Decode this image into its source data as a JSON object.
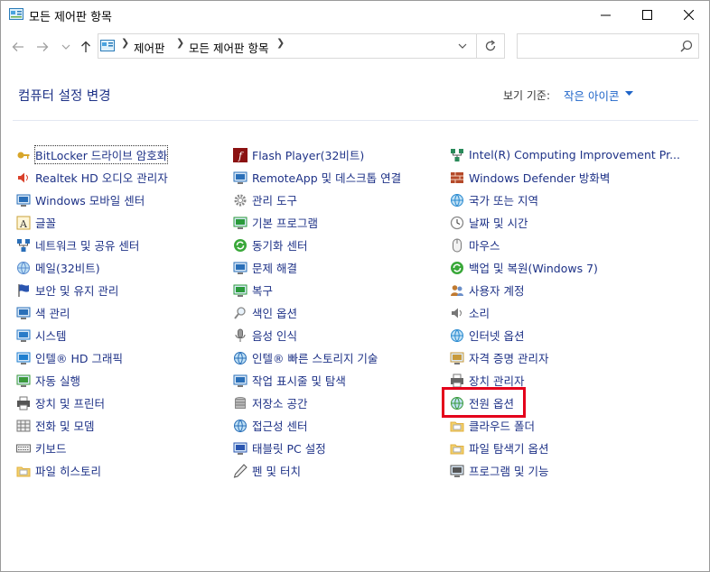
{
  "window": {
    "title": "모든 제어판 항목",
    "controls": [
      "minimize",
      "maximize",
      "close"
    ]
  },
  "nav": {
    "breadcrumb": [
      "제어판",
      "모든 제어판 항목"
    ],
    "search_placeholder": ""
  },
  "header": {
    "title": "컴퓨터 설정 변경",
    "view_label": "보기 기준:",
    "view_value": "작은 아이콘"
  },
  "columns": [
    [
      {
        "label": "BitLocker 드라이브 암호화",
        "icon": "bitlocker-icon"
      },
      {
        "label": "Realtek HD 오디오 관리자",
        "icon": "realtek-audio-icon"
      },
      {
        "label": "Windows 모바일 센터",
        "icon": "mobility-center-icon"
      },
      {
        "label": "글꼴",
        "icon": "fonts-icon"
      },
      {
        "label": "네트워크 및 공유 센터",
        "icon": "network-icon"
      },
      {
        "label": "메일(32비트)",
        "icon": "mail-icon"
      },
      {
        "label": "보안 및 유지 관리",
        "icon": "flag-icon"
      },
      {
        "label": "색 관리",
        "icon": "color-management-icon"
      },
      {
        "label": "시스템",
        "icon": "system-icon"
      },
      {
        "label": "인텔® HD 그래픽",
        "icon": "intel-graphics-icon"
      },
      {
        "label": "자동 실행",
        "icon": "autoplay-icon"
      },
      {
        "label": "장치 및 프린터",
        "icon": "devices-printers-icon"
      },
      {
        "label": "전화 및 모뎀",
        "icon": "phone-modem-icon"
      },
      {
        "label": "키보드",
        "icon": "keyboard-icon"
      },
      {
        "label": "파일 히스토리",
        "icon": "file-history-icon"
      }
    ],
    [
      {
        "label": "Flash Player(32비트)",
        "icon": "flash-icon"
      },
      {
        "label": "RemoteApp 및 데스크톱 연결",
        "icon": "remoteapp-icon"
      },
      {
        "label": "관리 도구",
        "icon": "admin-tools-icon"
      },
      {
        "label": "기본 프로그램",
        "icon": "default-programs-icon"
      },
      {
        "label": "동기화 센터",
        "icon": "sync-center-icon"
      },
      {
        "label": "문제 해결",
        "icon": "troubleshooting-icon"
      },
      {
        "label": "복구",
        "icon": "recovery-icon"
      },
      {
        "label": "색인 옵션",
        "icon": "indexing-icon"
      },
      {
        "label": "음성 인식",
        "icon": "speech-recognition-icon"
      },
      {
        "label": "인텔® 빠른 스토리지 기술",
        "icon": "intel-rst-icon"
      },
      {
        "label": "작업 표시줄 및 탐색",
        "icon": "taskbar-icon"
      },
      {
        "label": "저장소 공간",
        "icon": "storage-spaces-icon"
      },
      {
        "label": "접근성 센터",
        "icon": "ease-of-access-icon"
      },
      {
        "label": "태블릿 PC 설정",
        "icon": "tablet-pc-icon"
      },
      {
        "label": "펜 및 터치",
        "icon": "pen-touch-icon"
      }
    ],
    [
      {
        "label": "Intel(R) Computing Improvement Pr...",
        "icon": "intel-cip-icon"
      },
      {
        "label": "Windows Defender 방화벽",
        "icon": "firewall-icon"
      },
      {
        "label": "국가 또는 지역",
        "icon": "region-icon"
      },
      {
        "label": "날짜 및 시간",
        "icon": "date-time-icon"
      },
      {
        "label": "마우스",
        "icon": "mouse-icon"
      },
      {
        "label": "백업 및 복원(Windows 7)",
        "icon": "backup-restore-icon"
      },
      {
        "label": "사용자 계정",
        "icon": "user-accounts-icon"
      },
      {
        "label": "소리",
        "icon": "sound-icon"
      },
      {
        "label": "인터넷 옵션",
        "icon": "internet-options-icon"
      },
      {
        "label": "자격 증명 관리자",
        "icon": "credential-manager-icon"
      },
      {
        "label": "장치 관리자",
        "icon": "device-manager-icon"
      },
      {
        "label": "전원 옵션",
        "icon": "power-options-icon"
      },
      {
        "label": "클라우드 폴더",
        "icon": "work-folders-icon"
      },
      {
        "label": "파일 탐색기 옵션",
        "icon": "folder-options-icon"
      },
      {
        "label": "프로그램 및 기능",
        "icon": "programs-features-icon"
      }
    ]
  ],
  "colors": {
    "link": "#1e3287",
    "accent": "#1e64c8",
    "highlight": "#e4001b"
  }
}
